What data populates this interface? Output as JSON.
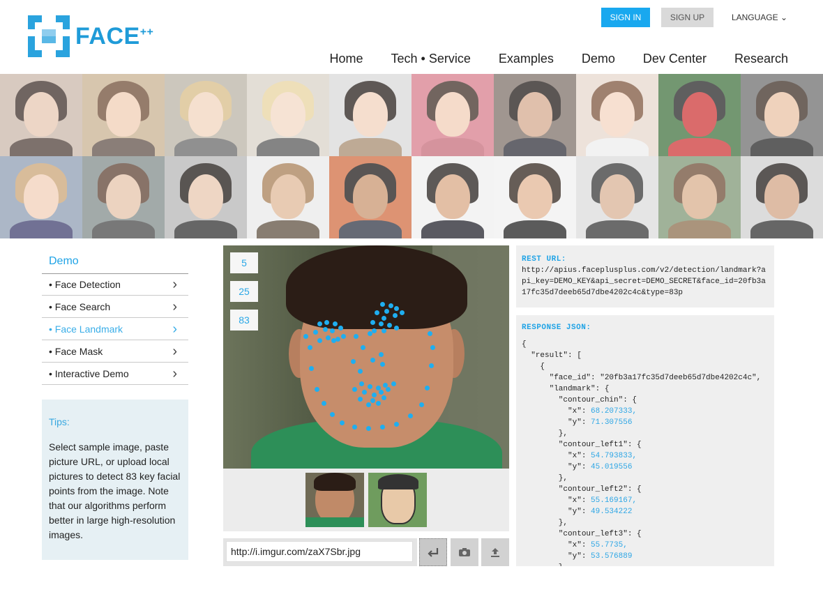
{
  "brand": {
    "name": "FACE",
    "sup": "++",
    "color": "#1f9bd8"
  },
  "auth": {
    "sign_in": "SIGN IN",
    "sign_up": "SIGN UP",
    "language": "LANGUAGE ⌄"
  },
  "nav": [
    "Home",
    "Tech • Service",
    "Examples",
    "Demo",
    "Dev Center",
    "Research"
  ],
  "sidebar": {
    "title": "Demo",
    "items": [
      {
        "label": "• Face Detection",
        "active": false
      },
      {
        "label": "• Face Search",
        "active": false
      },
      {
        "label": "• Face Landmark",
        "active": true
      },
      {
        "label": "• Face Mask",
        "active": false
      },
      {
        "label": "• Interactive Demo",
        "active": false
      }
    ],
    "tips_title": "Tips:",
    "tips_text": "Select sample image, paste picture URL, or upload local pictures to detect 83 key facial points from the image. Note that our algorithms perform better in large high-resolution images."
  },
  "viewer": {
    "point_counts": [
      "5",
      "25",
      "83"
    ]
  },
  "url_input": {
    "value": "http://i.imgur.com/zaX7Sbr.jpg"
  },
  "rest": {
    "label": "REST URL:",
    "url": "http://apius.faceplusplus.com/v2/detection/landmark?api_key=DEMO_KEY&api_secret=DEMO_SECRET&face_id=20fb3a17fc35d7deeb65d7dbe4202c4c&type=83p"
  },
  "response": {
    "label": "RESPONSE JSON:",
    "lines": [
      {
        "text": "{",
        "num": ""
      },
      {
        "text": "  \"result\": [",
        "num": ""
      },
      {
        "text": "    {",
        "num": ""
      },
      {
        "text": "      \"face_id\": \"20fb3a17fc35d7deeb65d7dbe4202c4c\",",
        "num": ""
      },
      {
        "text": "      \"landmark\": {",
        "num": ""
      },
      {
        "text": "        \"contour_chin\": {",
        "num": ""
      },
      {
        "text": "          \"x\": ",
        "num": "68.207333,"
      },
      {
        "text": "          \"y\": ",
        "num": "71.307556"
      },
      {
        "text": "        },",
        "num": ""
      },
      {
        "text": "        \"contour_left1\": {",
        "num": ""
      },
      {
        "text": "          \"x\": ",
        "num": "54.793833,"
      },
      {
        "text": "          \"y\": ",
        "num": "45.019556"
      },
      {
        "text": "        },",
        "num": ""
      },
      {
        "text": "        \"contour_left2\": {",
        "num": ""
      },
      {
        "text": "          \"x\": ",
        "num": "55.169167,"
      },
      {
        "text": "          \"y\": ",
        "num": "49.534222"
      },
      {
        "text": "        },",
        "num": ""
      },
      {
        "text": "        \"contour_left3\": {",
        "num": ""
      },
      {
        "text": "          \"x\": ",
        "num": "55.7735,"
      },
      {
        "text": "          \"y\": ",
        "num": "53.576889"
      },
      {
        "text": "        }",
        "num": ""
      }
    ]
  },
  "colors": {
    "accent": "#1fa3e6",
    "signin_bg": "#19a8ef",
    "landmark_point": "#1faef0"
  }
}
